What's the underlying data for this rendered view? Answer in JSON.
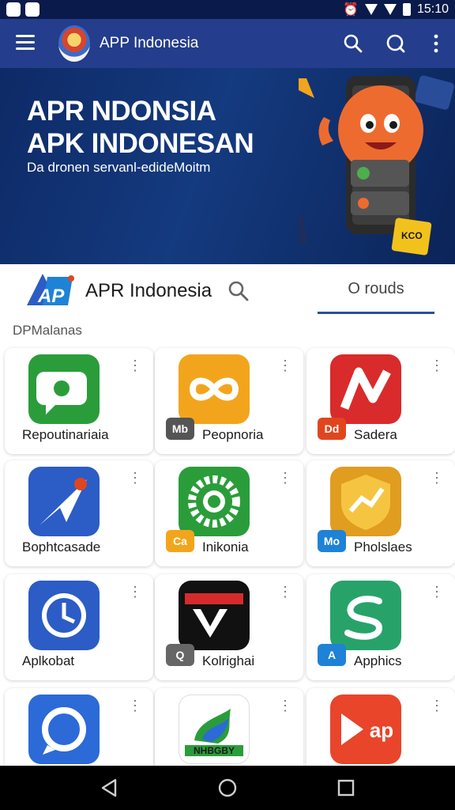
{
  "status_bar": {
    "time": "15:10"
  },
  "app_bar": {
    "title": "APP Indonesia"
  },
  "hero": {
    "title_line1": "APR NDONSIA",
    "title_line2": "APK INDONESAN",
    "subtitle": "Da dronen servanl-edideMoitm",
    "badge_text": "KCO"
  },
  "search_row": {
    "logo_text": "AP",
    "title": "APR Indonesia",
    "tab_label": "O rouds"
  },
  "section": {
    "label": "DPMalanas"
  },
  "apps": [
    {
      "name": "Repoutinariaia",
      "badge": "",
      "badge_color": "",
      "icon": "chat-bubble-icon",
      "color": "#2a9d3a"
    },
    {
      "name": "Peopnoria",
      "badge": "Mb",
      "badge_color": "#555555",
      "icon": "infinity-icon",
      "color": "#f2a51c"
    },
    {
      "name": "Sadera",
      "badge": "Dd",
      "badge_color": "#e0461e",
      "icon": "n-letter-icon",
      "color": "#d92b2b"
    },
    {
      "name": "Bophtcasade",
      "badge": "",
      "badge_color": "",
      "icon": "paper-plane-icon",
      "color": "#2c5cc5"
    },
    {
      "name": "Inikonia",
      "badge": "Ca",
      "badge_color": "#f2a51c",
      "icon": "gear-icon",
      "color": "#2a9d3a"
    },
    {
      "name": "Pholslaes",
      "badge": "Mo",
      "badge_color": "#1e82d6",
      "icon": "shield-chart-icon",
      "color": "#e09d20"
    },
    {
      "name": "Aplkobat",
      "badge": "",
      "badge_color": "",
      "icon": "clock-icon",
      "color": "#2c5cc5"
    },
    {
      "name": "Kolrighai",
      "badge": "Q",
      "badge_color": "#666666",
      "icon": "v-logo-icon",
      "color": "#111111"
    },
    {
      "name": "Apphics",
      "badge": "A",
      "badge_color": "#1e82d6",
      "icon": "s-swoosh-icon",
      "color": "#27a36a"
    },
    {
      "name": "",
      "badge": "",
      "badge_color": "",
      "icon": "chat-ring-icon",
      "color": "#2c6ad8"
    },
    {
      "name": "",
      "badge": "",
      "badge_color": "",
      "icon": "flame-icon",
      "color": "#ffffff",
      "label": "NHBGBY"
    },
    {
      "name": "",
      "badge": "",
      "badge_color": "",
      "icon": "play-icon",
      "color": "#e8452a",
      "label": "ap"
    }
  ]
}
